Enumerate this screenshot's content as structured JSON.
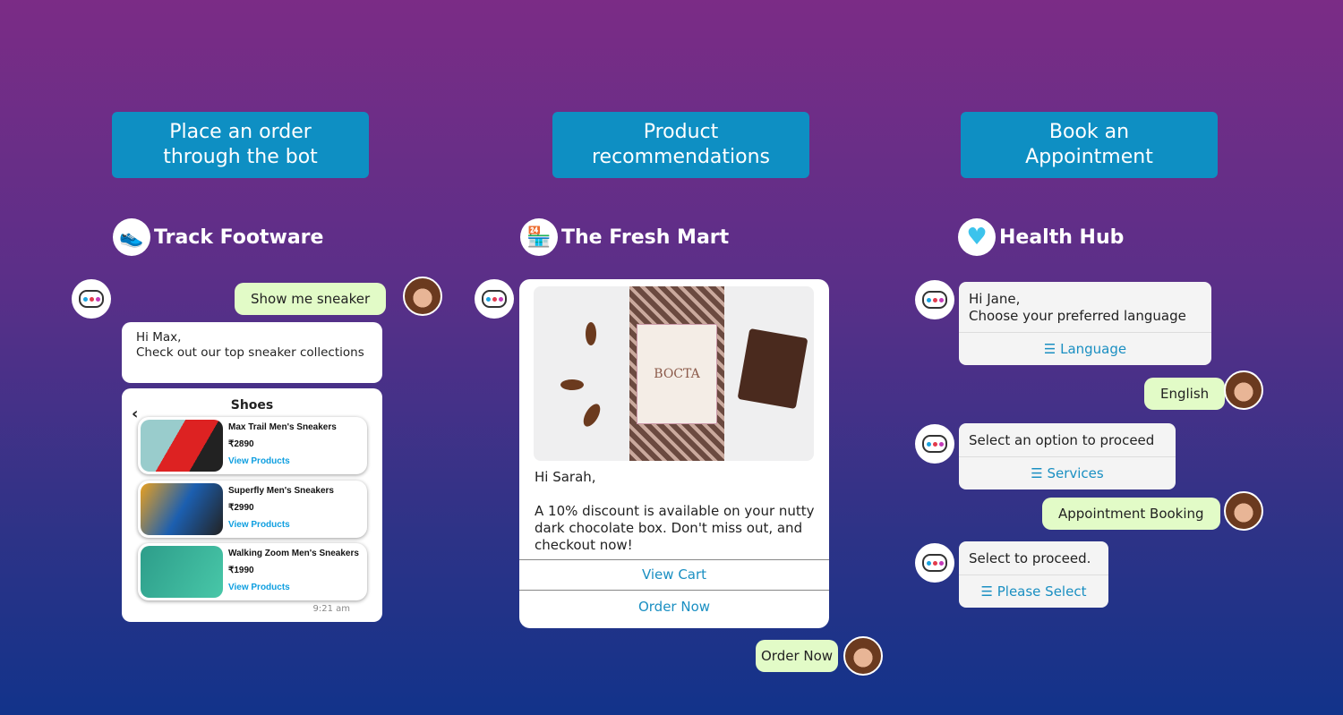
{
  "headers": [
    "Place an order\nthrough the bot",
    "Product\nrecommendations",
    "Book an\nAppointment"
  ],
  "colors": {
    "header_bg": "#0e8fc3",
    "user_bubble": "#e2fbc7",
    "link": "#1a8fc2"
  },
  "footware": {
    "brand": "Track Footware",
    "logo_icon": "shoe-icon",
    "user_msg": "Show me sneaker",
    "bot_msg": "Hi Max,\nCheck out our  top sneaker collections",
    "carousel_title": "Shoes",
    "products": [
      {
        "name": "Max Trail Men's Sneakers",
        "price": "₹2890",
        "link": "View Products"
      },
      {
        "name": "Superfly Men's Sneakers",
        "price": "₹2990",
        "link": "View Products"
      },
      {
        "name": "Walking Zoom Men's Sneakers",
        "price": "₹1990",
        "link": "View Products"
      }
    ],
    "time": "9:21 am"
  },
  "mart": {
    "brand": "The Fresh Mart",
    "logo_icon": "shop-icon",
    "product_label": "BOCTA",
    "message": "Hi Sarah,\n\nA 10% discount is available on your nutty dark chocolate box. Don't miss out, and checkout now!",
    "buttons": [
      "View Cart",
      "Order Now"
    ],
    "user_msg": "Order Now"
  },
  "health": {
    "brand": "Health Hub",
    "logo_icon": "heart-plus-icon",
    "msg1": "Hi Jane,\nChoose your preferred language",
    "btn1": "Language",
    "user1": "English",
    "msg2": "Select an option to proceed",
    "btn2": "Services",
    "user2": "Appointment Booking",
    "msg3": "Select to proceed.",
    "btn3": "Please Select"
  }
}
